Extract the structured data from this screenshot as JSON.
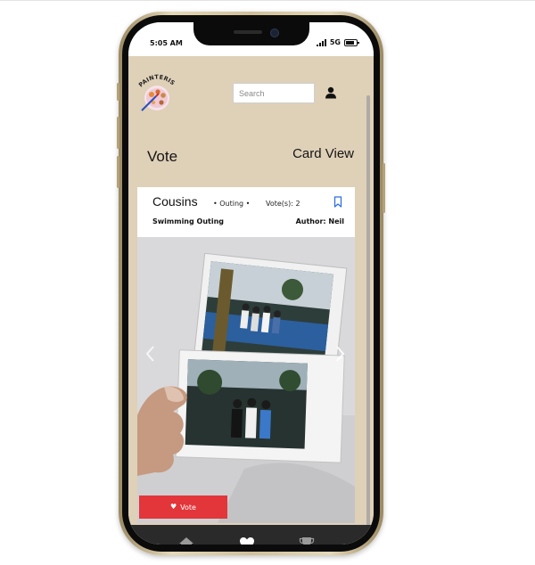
{
  "status_bar": {
    "time": "5:05 AM",
    "network": "5G"
  },
  "header": {
    "logo_text": "PAINTERIST",
    "search": {
      "placeholder": "Search",
      "value": ""
    }
  },
  "page": {
    "title": "Vote",
    "view_toggle": "Card View"
  },
  "card": {
    "title": "Cousins",
    "category": "• Outing •",
    "votes": "Vote(s): 2",
    "subtitle": "Swimming Outing",
    "author": "Author: Neil"
  },
  "vote_button": {
    "label": "Vote"
  },
  "icons": {
    "user": "user-icon",
    "bookmark": "bookmark-icon",
    "chevron_right": "chevron-right-icon",
    "chevron_left": "chevron-left-icon",
    "heart": "heart-icon",
    "home": "home-icon",
    "trophy": "trophy-icon"
  },
  "colors": {
    "background": "#dfd0b8",
    "accent_red": "#e2363a",
    "bookmark_blue": "#2f6fe0",
    "nav_bg": "#2a2a2a",
    "nav_icon": "#9a9a9a",
    "nav_active": "#ffffff"
  },
  "bottom_nav": {
    "active": "heart"
  }
}
